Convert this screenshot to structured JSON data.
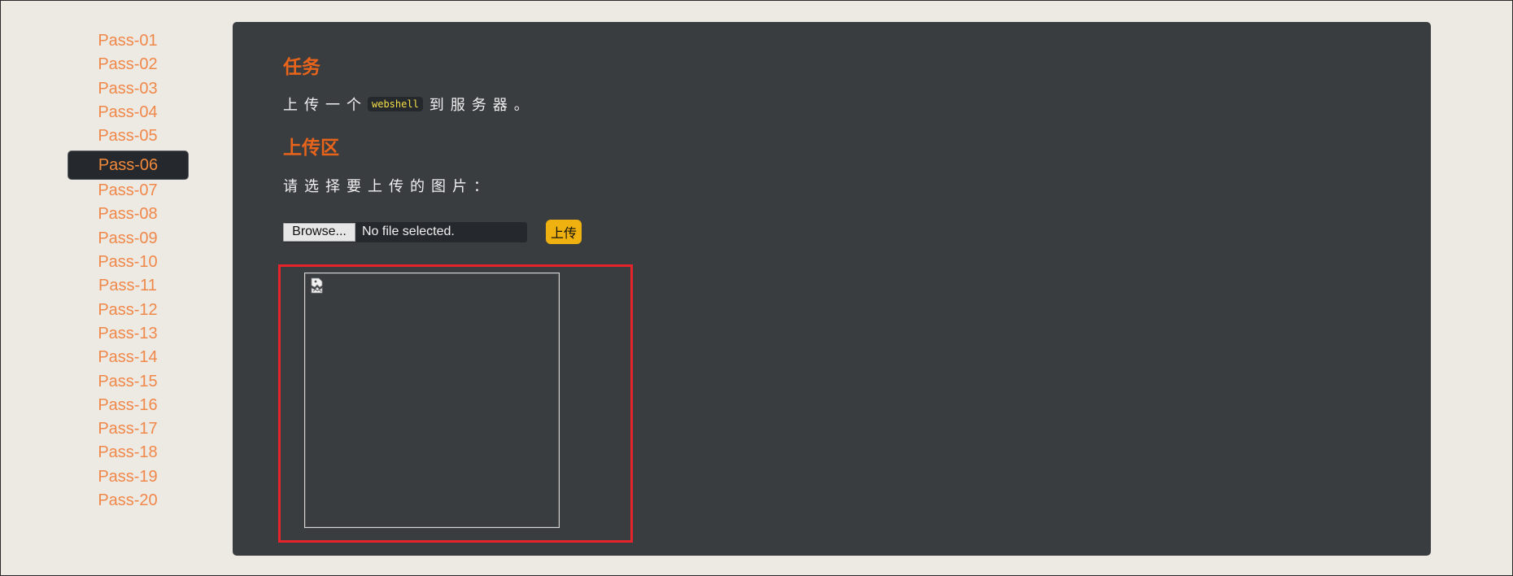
{
  "sidebar": {
    "items": [
      {
        "label": "Pass-01"
      },
      {
        "label": "Pass-02"
      },
      {
        "label": "Pass-03"
      },
      {
        "label": "Pass-04"
      },
      {
        "label": "Pass-05"
      },
      {
        "label": "Pass-06"
      },
      {
        "label": "Pass-07"
      },
      {
        "label": "Pass-08"
      },
      {
        "label": "Pass-09"
      },
      {
        "label": "Pass-10"
      },
      {
        "label": "Pass-11"
      },
      {
        "label": "Pass-12"
      },
      {
        "label": "Pass-13"
      },
      {
        "label": "Pass-14"
      },
      {
        "label": "Pass-15"
      },
      {
        "label": "Pass-16"
      },
      {
        "label": "Pass-17"
      },
      {
        "label": "Pass-18"
      },
      {
        "label": "Pass-19"
      },
      {
        "label": "Pass-20"
      }
    ],
    "active_label": "Pass-06"
  },
  "task": {
    "heading": "任务",
    "text_before": "上传一个",
    "code": "webshell",
    "text_after": "到服务器。"
  },
  "upload": {
    "heading": "上传区",
    "prompt": "请选择要上传的图片：",
    "browse_label": "Browse...",
    "file_status": "No file selected.",
    "submit_label": "上传"
  },
  "preview": {
    "icon": "broken-image-icon"
  },
  "colors": {
    "page_bg": "#ede9e3",
    "panel_bg": "#3a3d40",
    "link_orange": "#f0884a",
    "heading_orange": "#e9641b",
    "upload_button": "#efb10f",
    "highlight_red": "#e5232a",
    "code_yellow": "#f5e049"
  }
}
